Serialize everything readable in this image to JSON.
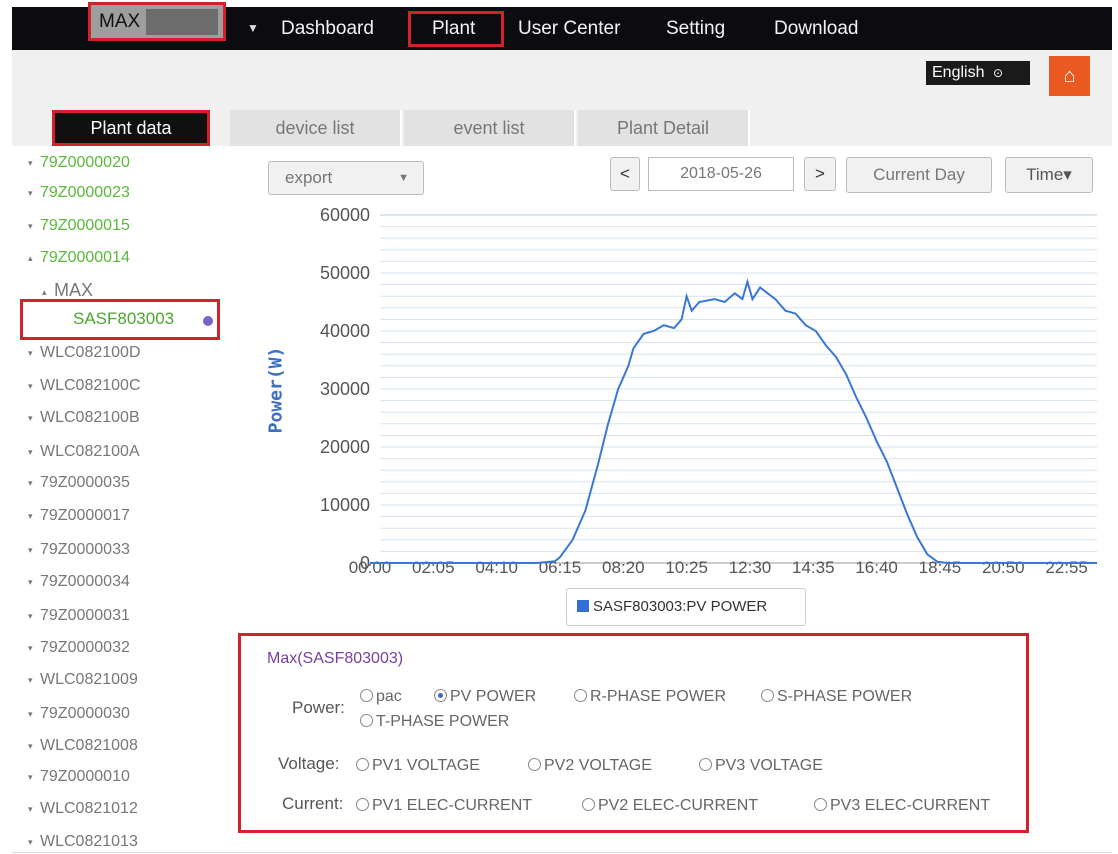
{
  "nav": {
    "site_label": "MAX",
    "items": [
      {
        "label": "Dashboard"
      },
      {
        "label": "Plant"
      },
      {
        "label": "User Center"
      },
      {
        "label": "Setting"
      },
      {
        "label": "Download"
      }
    ],
    "active": "Plant"
  },
  "header": {
    "language": "English",
    "language_icon": "dropdown-circle-icon",
    "home_icon": "home-icon"
  },
  "tabs": [
    {
      "label": "Plant data",
      "active": true
    },
    {
      "label": "device list",
      "active": false
    },
    {
      "label": "event list",
      "active": false
    },
    {
      "label": "Plant Detail",
      "active": false
    }
  ],
  "tree": {
    "items": [
      {
        "label": "79Z0000020",
        "bullet": "▾",
        "color": "#58b93a"
      },
      {
        "label": "79Z0000023",
        "bullet": "▾",
        "color": "#58b93a"
      },
      {
        "label": "79Z0000015",
        "bullet": "▾",
        "color": "#58b93a"
      },
      {
        "label": "79Z0000014",
        "bullet": "▴",
        "color": "#58b93a"
      },
      {
        "label": "MAX",
        "bullet": "▴",
        "color": "#777777"
      },
      {
        "label": "WLC082100D",
        "bullet": "▾",
        "color": "#777777"
      },
      {
        "label": "WLC082100C",
        "bullet": "▾",
        "color": "#777777"
      },
      {
        "label": "WLC082100B",
        "bullet": "▾",
        "color": "#777777"
      },
      {
        "label": "WLC082100A",
        "bullet": "▾",
        "color": "#777777"
      },
      {
        "label": "79Z0000035",
        "bullet": "▾",
        "color": "#777777"
      },
      {
        "label": "79Z0000017",
        "bullet": "▾",
        "color": "#777777"
      },
      {
        "label": "79Z0000033",
        "bullet": "▾",
        "color": "#777777"
      },
      {
        "label": "79Z0000034",
        "bullet": "▾",
        "color": "#777777"
      },
      {
        "label": "79Z0000031",
        "bullet": "▾",
        "color": "#777777"
      },
      {
        "label": "79Z0000032",
        "bullet": "▾",
        "color": "#777777"
      },
      {
        "label": "WLC0821009",
        "bullet": "▾",
        "color": "#777777"
      },
      {
        "label": "79Z0000030",
        "bullet": "▾",
        "color": "#777777"
      },
      {
        "label": "WLC0821008",
        "bullet": "▾",
        "color": "#777777"
      },
      {
        "label": "79Z0000010",
        "bullet": "▾",
        "color": "#777777"
      },
      {
        "label": "WLC0821012",
        "bullet": "▾",
        "color": "#777777"
      },
      {
        "label": "WLC0821013",
        "bullet": "▾",
        "color": "#777777"
      }
    ],
    "selected": {
      "label": "SASF803003",
      "dot_color": "#7b61c9"
    }
  },
  "toolbar": {
    "export_label": "export",
    "prev_label": "<",
    "date": "2018-05-26",
    "next_label": ">",
    "current_day_label": "Current Day",
    "time_label": "Time▾"
  },
  "chart_data": {
    "type": "line",
    "title": "",
    "xlabel": "",
    "ylabel": "Power(W)",
    "ylim": [
      0,
      60000
    ],
    "yticks": [
      0,
      10000,
      20000,
      30000,
      40000,
      50000,
      60000
    ],
    "xlim": [
      "00:00",
      "23:55"
    ],
    "xticks": [
      "00:00",
      "02:05",
      "04:10",
      "06:15",
      "08:20",
      "10:25",
      "12:30",
      "14:35",
      "16:40",
      "18:45",
      "20:50",
      "22:55"
    ],
    "grid": true,
    "series": [
      {
        "name": "SASF803003:PV POWER",
        "color": "#3a78d6",
        "points": [
          [
            "00:00",
            0
          ],
          [
            "05:30",
            0
          ],
          [
            "06:05",
            300
          ],
          [
            "06:15",
            1000
          ],
          [
            "06:40",
            4000
          ],
          [
            "07:05",
            9000
          ],
          [
            "07:30",
            17000
          ],
          [
            "07:50",
            24000
          ],
          [
            "08:10",
            30000
          ],
          [
            "08:30",
            34000
          ],
          [
            "08:40",
            37000
          ],
          [
            "09:00",
            39500
          ],
          [
            "09:20",
            40000
          ],
          [
            "09:40",
            41000
          ],
          [
            "10:00",
            40500
          ],
          [
            "10:15",
            42000
          ],
          [
            "10:25",
            46000
          ],
          [
            "10:35",
            43500
          ],
          [
            "10:50",
            45000
          ],
          [
            "11:20",
            45500
          ],
          [
            "11:40",
            45000
          ],
          [
            "12:00",
            46500
          ],
          [
            "12:15",
            45500
          ],
          [
            "12:25",
            48500
          ],
          [
            "12:35",
            45500
          ],
          [
            "12:50",
            47500
          ],
          [
            "13:05",
            46500
          ],
          [
            "13:20",
            45500
          ],
          [
            "13:40",
            43500
          ],
          [
            "14:00",
            43000
          ],
          [
            "14:20",
            41000
          ],
          [
            "14:40",
            40000
          ],
          [
            "15:00",
            37500
          ],
          [
            "15:20",
            35500
          ],
          [
            "15:40",
            32500
          ],
          [
            "16:00",
            28500
          ],
          [
            "16:20",
            25000
          ],
          [
            "16:40",
            21000
          ],
          [
            "17:00",
            17500
          ],
          [
            "17:20",
            13000
          ],
          [
            "17:40",
            8500
          ],
          [
            "18:00",
            4500
          ],
          [
            "18:20",
            1500
          ],
          [
            "18:40",
            200
          ],
          [
            "19:00",
            0
          ],
          [
            "23:55",
            0
          ]
        ]
      }
    ],
    "legend": {
      "label": "SASF803003:PV POWER",
      "position": "bottom"
    }
  },
  "options": {
    "title": "Max(SASF803003)",
    "power_label": "Power:",
    "voltage_label": "Voltage:",
    "current_label": "Current:",
    "power": [
      {
        "label": "pac",
        "checked": false
      },
      {
        "label": "PV POWER",
        "checked": true
      },
      {
        "label": "R-PHASE POWER",
        "checked": false
      },
      {
        "label": "S-PHASE POWER",
        "checked": false
      },
      {
        "label": "T-PHASE POWER",
        "checked": false
      }
    ],
    "voltage": [
      {
        "label": "PV1 VOLTAGE",
        "checked": false
      },
      {
        "label": "PV2 VOLTAGE",
        "checked": false
      },
      {
        "label": "PV3 VOLTAGE",
        "checked": false
      }
    ],
    "current": [
      {
        "label": "PV1 ELEC-CURRENT",
        "checked": false
      },
      {
        "label": "PV2 ELEC-CURRENT",
        "checked": false
      },
      {
        "label": "PV3 ELEC-CURRENT",
        "checked": false
      }
    ]
  }
}
